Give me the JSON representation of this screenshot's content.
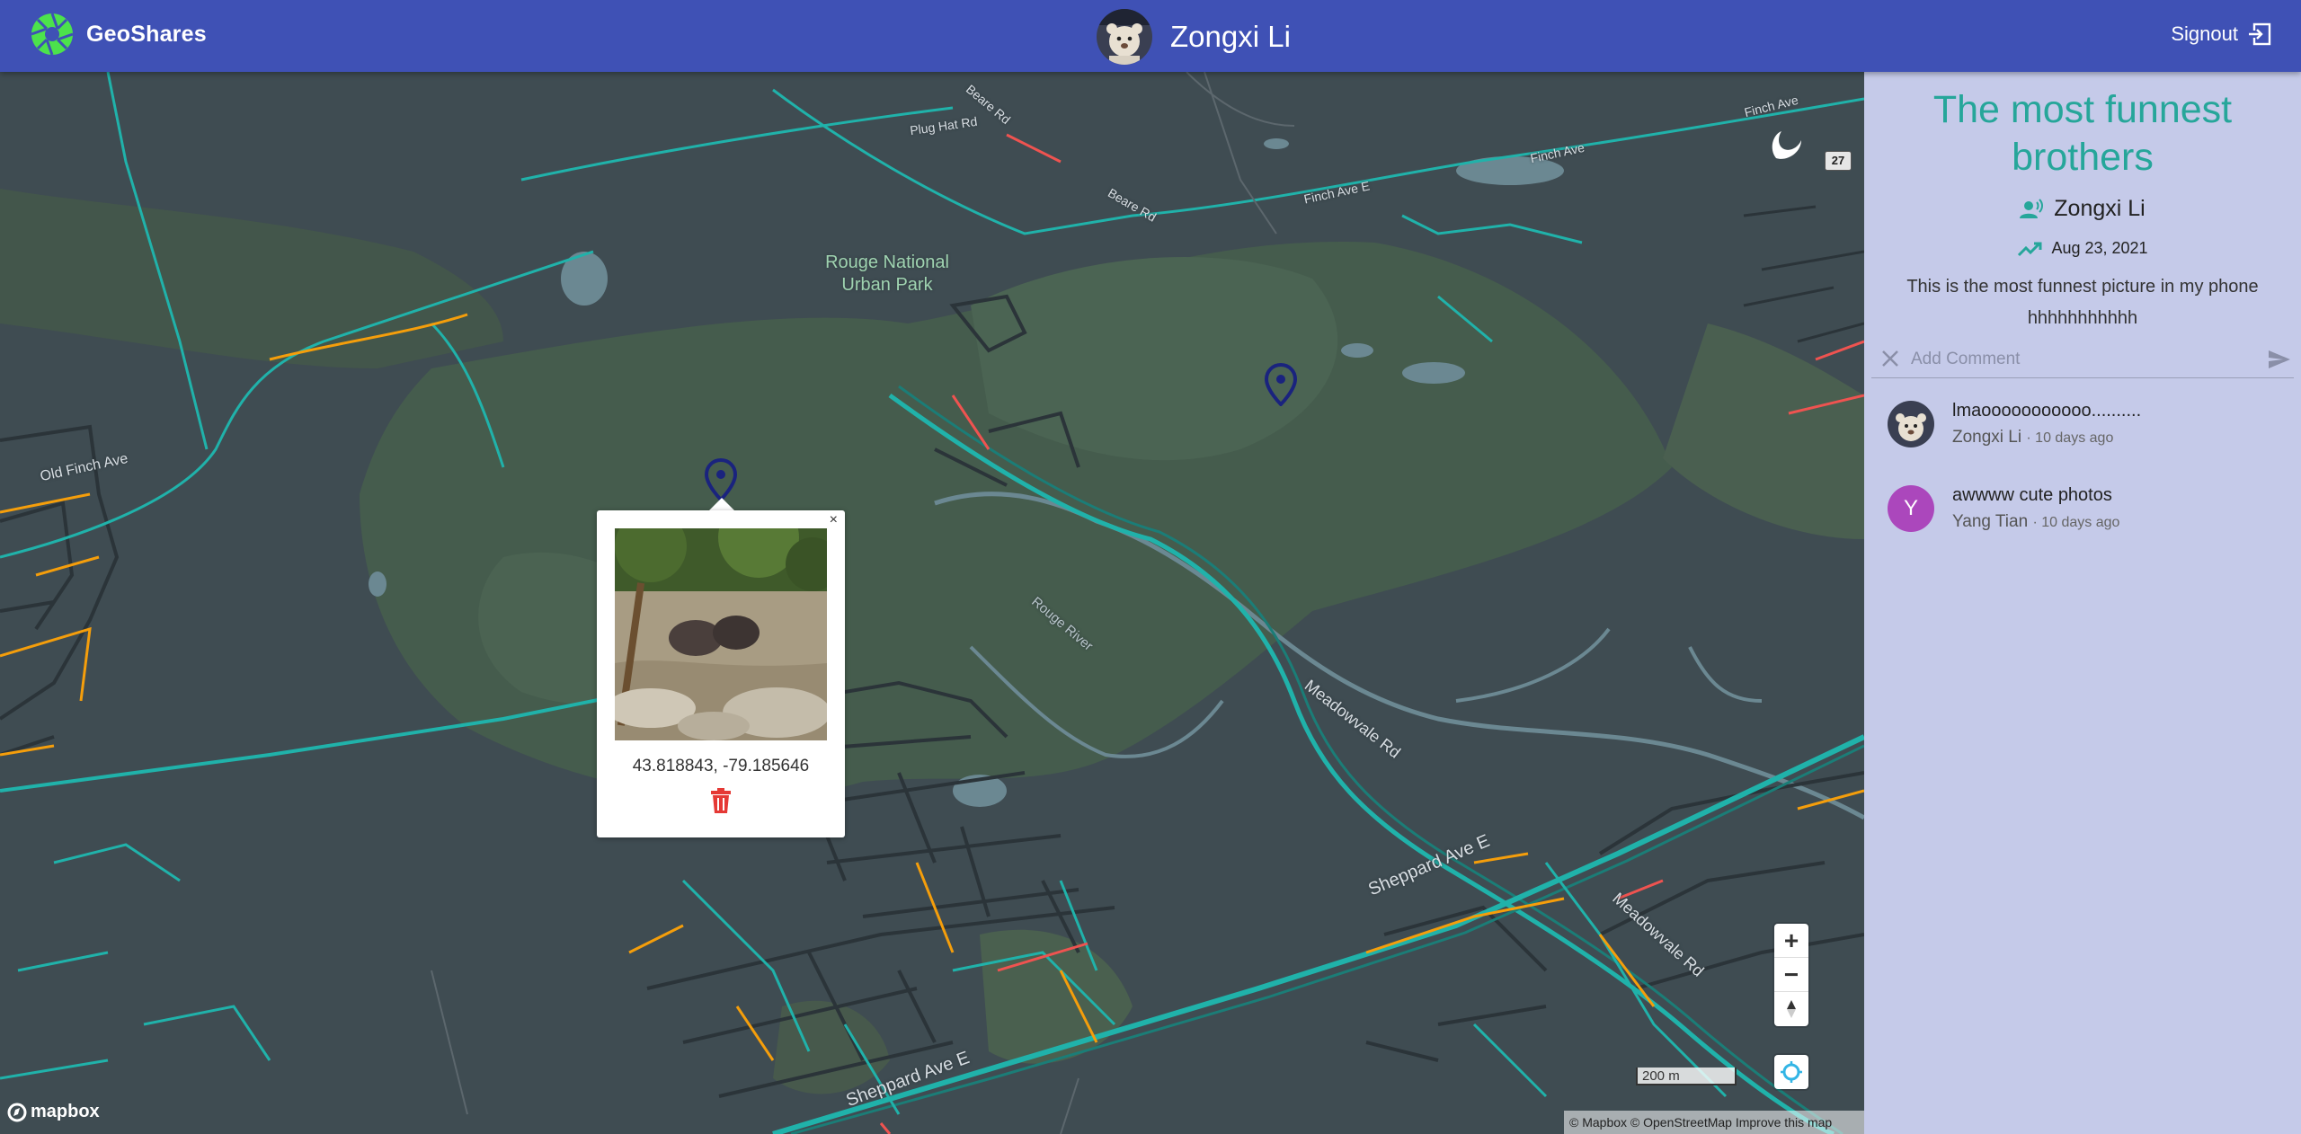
{
  "header": {
    "brand": "GeoShares",
    "user_name": "Zongxi Li",
    "signout_label": "Signout"
  },
  "map": {
    "road_labels": {
      "old_finch": "Old Finch Ave",
      "plug_hat": "Plug Hat Rd",
      "beare_top": "Beare Rd",
      "beare_mid": "Beare Rd",
      "finch_e": "Finch Ave E",
      "finch_1": "Finch Ave",
      "finch_2": "Finch Ave",
      "rouge_river": "Rouge River",
      "meadowvale_1": "Meadowvale Rd",
      "meadowvale_2": "Meadowvale Rd",
      "sheppard_1": "Sheppard Ave E",
      "sheppard_2": "Sheppard Ave E"
    },
    "park_label": "Rouge National Urban Park",
    "route_shield": "27",
    "popup": {
      "close": "×",
      "coordinates": "43.818843, -79.185646"
    },
    "scale_label": "200 m",
    "attribution": {
      "mapbox": "© Mapbox",
      "osm": "© OpenStreetMap",
      "improve": "Improve this map"
    },
    "logo": "mapbox",
    "controls": {
      "zoom_in": "+",
      "zoom_out": "−"
    }
  },
  "colors": {
    "header": "#3f51b5",
    "accent": "#26a69a",
    "panel": "#c5cae9",
    "marker": "#1a237e",
    "delete": "#e53935",
    "avatar_y": "#ab47bc"
  },
  "post": {
    "title": "The most funnest brothers",
    "author": "Zongxi Li",
    "date": "Aug 23, 2021",
    "description": "This is the most funnest picture in my phone hhhhhhhhhhh",
    "comment_placeholder": "Add Comment"
  },
  "comments": [
    {
      "text": "lmaooooooooooo..........",
      "author": "Zongxi Li",
      "time": "· 10 days ago"
    },
    {
      "initial": "Y",
      "text": "awwww cute photos",
      "author": "Yang Tian",
      "time": "· 10 days ago"
    }
  ]
}
